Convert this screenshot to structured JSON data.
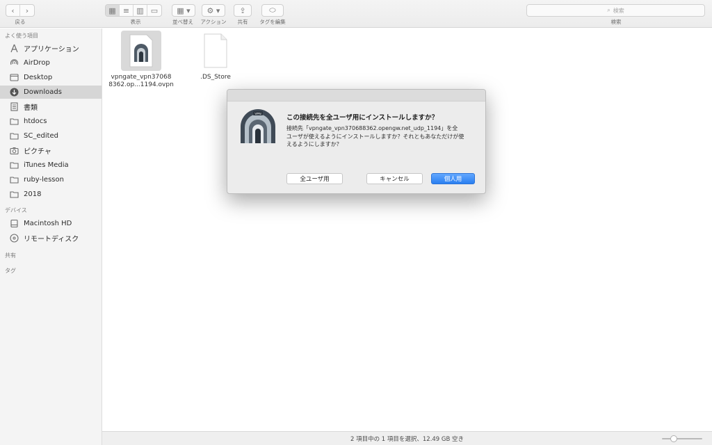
{
  "toolbar": {
    "back_label": "戻る",
    "view_label": "表示",
    "sort_label": "並べ替え",
    "action_label": "アクション",
    "share_label": "共有",
    "tag_label": "タグを編集",
    "search_placeholder": "検索",
    "search_label": "検索"
  },
  "sidebar": {
    "favorites_heading": "よく使う項目",
    "items": [
      {
        "label": "アプリケーション",
        "icon": "applications-icon"
      },
      {
        "label": "AirDrop",
        "icon": "airdrop-icon"
      },
      {
        "label": "Desktop",
        "icon": "desktop-icon"
      },
      {
        "label": "Downloads",
        "icon": "downloads-icon"
      },
      {
        "label": "書類",
        "icon": "documents-icon"
      },
      {
        "label": "htdocs",
        "icon": "folder-icon"
      },
      {
        "label": "SC_edited",
        "icon": "folder-icon"
      },
      {
        "label": "ピクチャ",
        "icon": "camera-icon"
      },
      {
        "label": "iTunes Media",
        "icon": "folder-icon"
      },
      {
        "label": "ruby-lesson",
        "icon": "folder-icon"
      },
      {
        "label": "2018",
        "icon": "folder-icon"
      }
    ],
    "devices_heading": "デバイス",
    "devices": [
      {
        "label": "Macintosh HD",
        "icon": "hard-drive-icon"
      },
      {
        "label": "リモートディスク",
        "icon": "remote-disc-icon"
      }
    ],
    "shared_heading": "共有",
    "tags_heading": "タグ"
  },
  "files": [
    {
      "name_line1": "vpngate_vpn37068",
      "name_line2": "8362.op...1194.ovpn",
      "selected": true
    },
    {
      "name_line1": ".DS_Store",
      "name_line2": "",
      "selected": false
    }
  ],
  "dialog": {
    "title": "この接続先を全ユーザ用にインストールしますか？",
    "message_line1": "接続先「vpngate_vpn370688362.opengw.net_udp_1194」を全",
    "message_line2": "ユーザが使えるようにインストールしますか？それともあなただけが使",
    "message_line3": "えるようにしますか？",
    "icon_text": "VPN",
    "btn_all_users": "全ユーザ用",
    "btn_cancel": "キャンセル",
    "btn_personal": "個人用"
  },
  "status": {
    "text": "2 項目中の 1 項目を選択、12.49 GB 空き"
  },
  "colors": {
    "primary_button": "#2a7ff0",
    "selection": "#d6d6d6"
  }
}
